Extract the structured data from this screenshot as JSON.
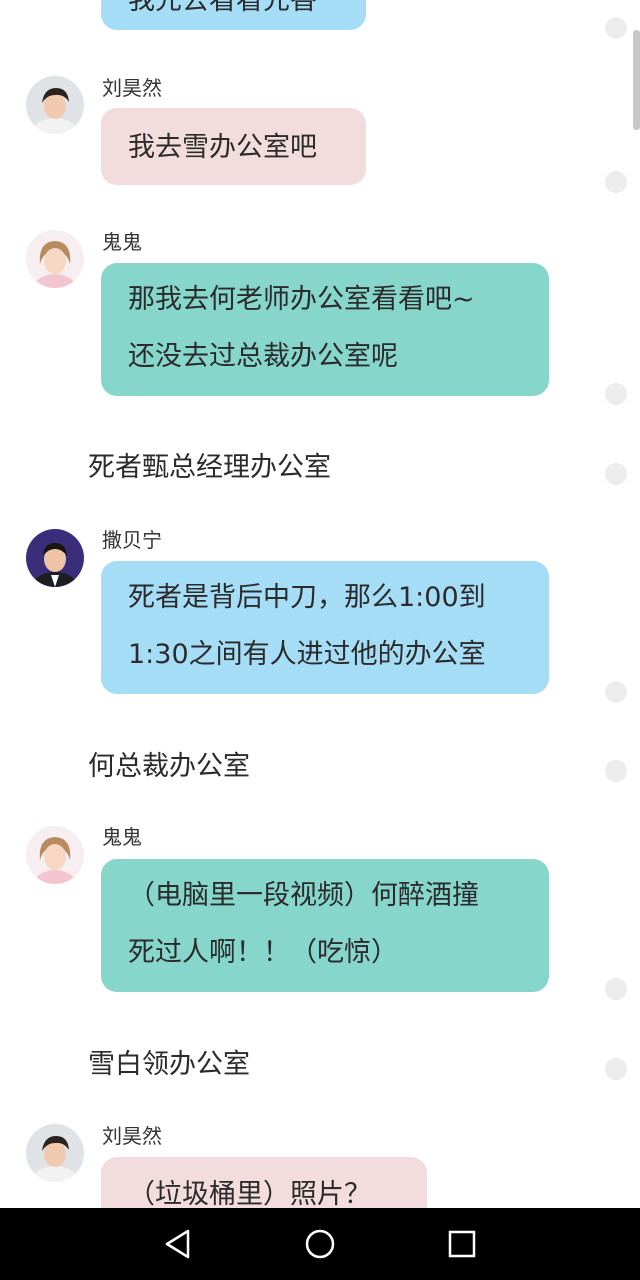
{
  "messages": [
    {
      "text": "我先去看看先香"
    },
    {
      "sender": "刘昊然",
      "lines": [
        "我去雪办公室吧"
      ]
    },
    {
      "sender": "鬼鬼",
      "lines": [
        "那我去何老师办公室看看吧~",
        "还没去过总裁办公室呢"
      ]
    },
    {
      "sender": "撒贝宁",
      "lines": [
        "死者是背后中刀，那么1:00到",
        "1:30之间有人进过他的办公室"
      ]
    },
    {
      "sender": "鬼鬼",
      "lines": [
        "（电脑里一段视频）何醉酒撞",
        "死过人啊！！（吃惊）"
      ]
    },
    {
      "sender": "刘昊然",
      "lines": [
        "（垃圾桶里）照片？"
      ]
    }
  ],
  "scenes": [
    "死者甄总经理办公室",
    "何总裁办公室",
    "雪白领办公室"
  ],
  "colors": {
    "bubble_blue": "#a5dcf6",
    "bubble_pink": "#f3dcdd",
    "bubble_green": "#87d6cc"
  },
  "navbar": {
    "icons": [
      "back-triangle-icon",
      "home-circle-icon",
      "recents-square-icon"
    ]
  }
}
